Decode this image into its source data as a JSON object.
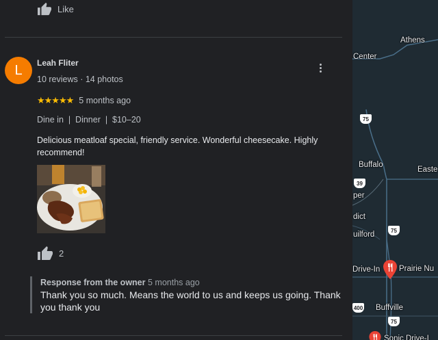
{
  "top_like": {
    "label": "Like"
  },
  "review": {
    "avatar_letter": "L",
    "author": "Leah Fliter",
    "author_meta": "10 reviews · 14 photos",
    "stars": "★★★★★",
    "rating": 5,
    "time": "5 months ago",
    "details": "Dine in  |  Dinner  |  $10–20",
    "text": "Delicious meatloaf special, friendly service. Wonderful cheesecake. Highly recommend!",
    "like_count": "2"
  },
  "owner_response": {
    "heading": "Response from the owner",
    "time": "5 months ago",
    "text": "Thank you so much. Means the world to us and keeps us going. Thank you thank you"
  },
  "map": {
    "labels": {
      "athens": "Athens",
      "center": "Center",
      "buffalo": "Buffalo",
      "east": "Easte",
      "per": "per",
      "dict": "dict",
      "guilford": "uilford",
      "drive_in": "Drive-In",
      "prairie": "Prairie Nu",
      "buffville": "Buffville",
      "sonic": "Sonic Drive-I"
    },
    "shields": {
      "s75a": "75",
      "s39": "39",
      "s75b": "75",
      "s400": "400",
      "s75c": "75"
    },
    "pin_color": "#ea4335"
  },
  "colors": {
    "accent_avatar": "#f57c00",
    "star": "#fbbc04",
    "background": "#202124"
  }
}
